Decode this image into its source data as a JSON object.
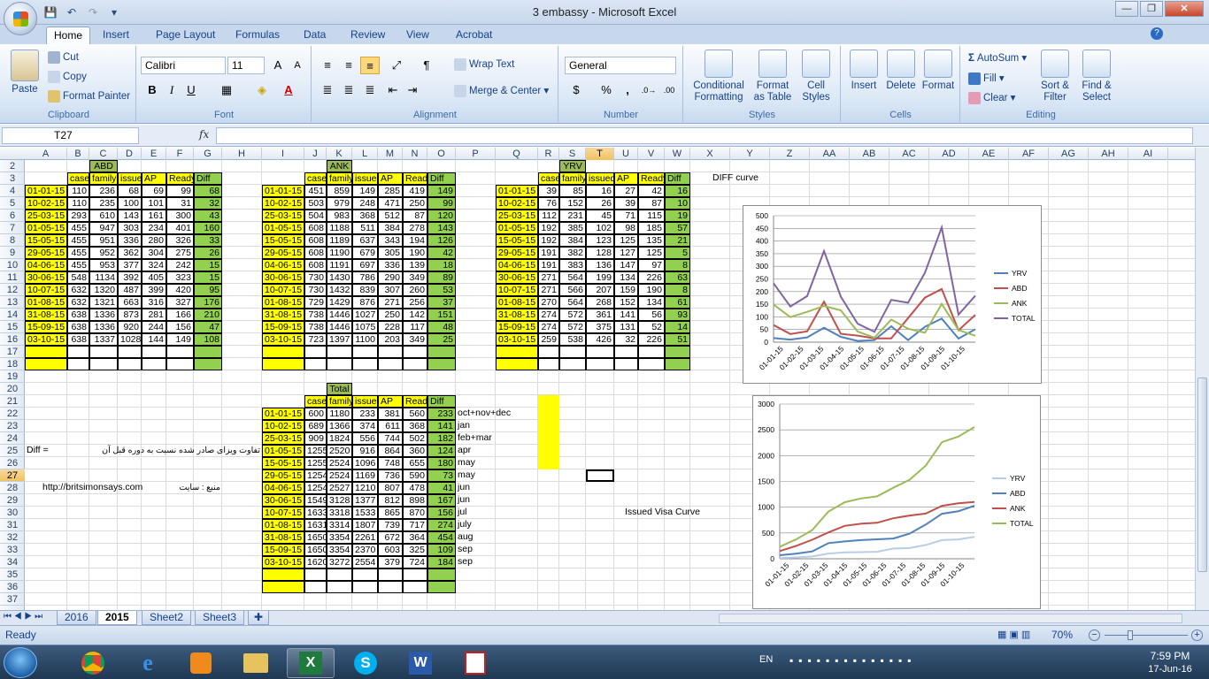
{
  "window": {
    "title": "3 embassy - Microsoft Excel",
    "minimize": "—",
    "restore": "❐",
    "close": "✕"
  },
  "ribbon_tabs": [
    "Home",
    "Insert",
    "Page Layout",
    "Formulas",
    "Data",
    "Review",
    "View",
    "Acrobat"
  ],
  "clipboard": {
    "paste": "Paste",
    "cut": "Cut",
    "copy": "Copy",
    "format_painter": "Format Painter",
    "group": "Clipboard"
  },
  "font": {
    "name": "Calibri",
    "size": "11",
    "bold": "B",
    "italic": "I",
    "underline": "U",
    "group": "Font"
  },
  "alignment": {
    "wrap": "Wrap Text",
    "merge": "Merge & Center",
    "group": "Alignment"
  },
  "number": {
    "format": "General",
    "currency": "$",
    "percent": "%",
    "comma": ",",
    "group": "Number"
  },
  "styles": {
    "conditional": "Conditional Formatting",
    "format_table": "Format as Table",
    "cell_styles": "Cell Styles",
    "group": "Styles"
  },
  "cells": {
    "insert": "Insert",
    "delete": "Delete",
    "format": "Format",
    "group": "Cells"
  },
  "editing": {
    "autosum": "AutoSum",
    "fill": "Fill",
    "clear": "Clear",
    "sort": "Sort & Filter",
    "find": "Find & Select",
    "group": "Editing"
  },
  "formula_bar": {
    "name_box": "T27",
    "fx": "fx",
    "value": ""
  },
  "columns": [
    "A",
    "B",
    "C",
    "D",
    "E",
    "F",
    "G",
    "H",
    "I",
    "J",
    "K",
    "L",
    "M",
    "N",
    "O",
    "P",
    "Q",
    "R",
    "S",
    "T",
    "U",
    "V",
    "W",
    "X",
    "Y",
    "Z",
    "AA",
    "AB",
    "AC",
    "AD",
    "AE",
    "AF",
    "AG",
    "AH",
    "AI"
  ],
  "rows": [
    "2",
    "3",
    "4",
    "5",
    "6",
    "7",
    "8",
    "9",
    "10",
    "11",
    "12",
    "13",
    "14",
    "15",
    "16",
    "17",
    "18",
    "19",
    "20",
    "21",
    "22",
    "23",
    "24",
    "25",
    "26",
    "27",
    "28",
    "29",
    "30",
    "31",
    "32",
    "33",
    "34",
    "35",
    "36",
    "37"
  ],
  "headers": [
    "case",
    "family",
    "issued",
    "AP",
    "Ready",
    "Diff"
  ],
  "dates": [
    "01-01-15",
    "10-02-15",
    "25-03-15",
    "01-05-15",
    "15-05-15",
    "29-05-15",
    "04-06-15",
    "30-06-15",
    "10-07-15",
    "01-08-15",
    "31-08-15",
    "15-09-15",
    "03-10-15"
  ],
  "abd": {
    "title": "ABD",
    "rows": [
      [
        110,
        236,
        68,
        69,
        99,
        68
      ],
      [
        110,
        235,
        100,
        101,
        31,
        32
      ],
      [
        293,
        610,
        143,
        161,
        300,
        43
      ],
      [
        455,
        947,
        303,
        234,
        401,
        160
      ],
      [
        455,
        951,
        336,
        280,
        326,
        33
      ],
      [
        455,
        952,
        362,
        304,
        275,
        26
      ],
      [
        455,
        953,
        377,
        324,
        242,
        15
      ],
      [
        548,
        1134,
        392,
        405,
        323,
        15
      ],
      [
        632,
        1320,
        487,
        399,
        420,
        95
      ],
      [
        632,
        1321,
        663,
        316,
        327,
        176
      ],
      [
        638,
        1336,
        873,
        281,
        166,
        210
      ],
      [
        638,
        1336,
        920,
        244,
        156,
        47
      ],
      [
        638,
        1337,
        1028,
        144,
        149,
        108
      ]
    ]
  },
  "ank": {
    "title": "ANK",
    "rows": [
      [
        451,
        859,
        149,
        285,
        419,
        149
      ],
      [
        503,
        979,
        248,
        471,
        250,
        99
      ],
      [
        504,
        983,
        368,
        512,
        87,
        120
      ],
      [
        608,
        1188,
        511,
        384,
        278,
        143
      ],
      [
        608,
        1189,
        637,
        343,
        194,
        126
      ],
      [
        608,
        1190,
        679,
        305,
        190,
        42
      ],
      [
        608,
        1191,
        697,
        336,
        139,
        18
      ],
      [
        730,
        1430,
        786,
        290,
        349,
        89
      ],
      [
        730,
        1432,
        839,
        307,
        260,
        53
      ],
      [
        729,
        1429,
        876,
        271,
        256,
        37
      ],
      [
        738,
        1446,
        1027,
        250,
        142,
        151
      ],
      [
        738,
        1446,
        1075,
        228,
        117,
        48
      ],
      [
        723,
        1397,
        1100,
        203,
        349,
        25
      ]
    ]
  },
  "yrv": {
    "title": "YRV",
    "rows": [
      [
        39,
        85,
        16,
        27,
        42,
        16
      ],
      [
        76,
        152,
        26,
        39,
        87,
        10
      ],
      [
        112,
        231,
        45,
        71,
        115,
        19
      ],
      [
        192,
        385,
        102,
        98,
        185,
        57
      ],
      [
        192,
        384,
        123,
        125,
        135,
        21
      ],
      [
        191,
        382,
        128,
        127,
        125,
        5
      ],
      [
        191,
        383,
        136,
        147,
        97,
        8
      ],
      [
        271,
        564,
        199,
        134,
        226,
        63
      ],
      [
        271,
        566,
        207,
        159,
        190,
        8
      ],
      [
        270,
        564,
        268,
        152,
        134,
        61
      ],
      [
        274,
        572,
        361,
        141,
        56,
        93
      ],
      [
        274,
        572,
        375,
        131,
        52,
        14
      ],
      [
        259,
        538,
        426,
        32,
        226,
        51
      ]
    ]
  },
  "total": {
    "title": "Total",
    "rows": [
      [
        600,
        1180,
        233,
        381,
        560,
        233
      ],
      [
        689,
        1366,
        374,
        611,
        368,
        141
      ],
      [
        909,
        1824,
        556,
        744,
        502,
        182
      ],
      [
        1255,
        2520,
        916,
        864,
        360,
        124
      ],
      [
        1255,
        2524,
        1096,
        748,
        655,
        180
      ],
      [
        1254,
        2524,
        1169,
        736,
        590,
        73
      ],
      [
        1254,
        2527,
        1210,
        807,
        478,
        41
      ],
      [
        1549,
        3128,
        1377,
        812,
        898,
        167
      ],
      [
        1633,
        3318,
        1533,
        865,
        870,
        156
      ],
      [
        1631,
        3314,
        1807,
        739,
        717,
        274
      ],
      [
        1650,
        3354,
        2261,
        672,
        364,
        454
      ],
      [
        1650,
        3354,
        2370,
        603,
        325,
        109
      ],
      [
        1620,
        3272,
        2554,
        379,
        724,
        184
      ]
    ],
    "notes": [
      "oct+nov+dec",
      "jan",
      "feb+mar",
      "apr",
      "may",
      "may",
      "jun",
      "jun",
      "jul",
      "july",
      "aug",
      "sep",
      "sep"
    ]
  },
  "diff_label": "Diff =",
  "diff_desc": "تفاوت ویزای صادر شده نسبت به دوره قبل آن",
  "source_url": "http://britsimonsays.com",
  "source_label": "منبع :  سایت",
  "chart1": {
    "title": "DIFF curve",
    "type": "line"
  },
  "chart2": {
    "title": "Issued Visa Curve",
    "type": "line"
  },
  "chart_data": [
    {
      "type": "line",
      "title": "DIFF curve",
      "categories": [
        "01-01-15",
        "01-02-15",
        "01-03-15",
        "01-04-15",
        "01-05-15",
        "01-06-15",
        "01-07-15",
        "01-08-15",
        "01-09-15",
        "01-10-15"
      ],
      "ylim": [
        0,
        500
      ],
      "yticks": [
        0,
        50,
        100,
        150,
        200,
        250,
        300,
        350,
        400,
        450,
        500
      ],
      "legend": "right",
      "series": [
        {
          "name": "YRV",
          "color": "#4f81bd",
          "values": [
            16,
            10,
            19,
            57,
            21,
            5,
            8,
            63,
            8,
            61,
            93,
            14,
            51
          ]
        },
        {
          "name": "ABD",
          "color": "#c0504d",
          "values": [
            68,
            32,
            43,
            160,
            33,
            26,
            15,
            15,
            95,
            176,
            210,
            47,
            108
          ]
        },
        {
          "name": "ANK",
          "color": "#9bbb59",
          "values": [
            149,
            99,
            120,
            143,
            126,
            42,
            18,
            89,
            53,
            37,
            151,
            48,
            25
          ]
        },
        {
          "name": "TOTAL",
          "color": "#8064a2",
          "values": [
            233,
            141,
            182,
            360,
            180,
            73,
            41,
            167,
            156,
            274,
            454,
            109,
            184
          ]
        }
      ]
    },
    {
      "type": "line",
      "title": "Issued Visa Curve",
      "categories": [
        "01-01-15",
        "01-02-15",
        "01-03-15",
        "01-04-15",
        "01-05-15",
        "01-06-15",
        "01-07-15",
        "01-08-15",
        "01-09-15",
        "01-10-15"
      ],
      "ylim": [
        0,
        3000
      ],
      "yticks": [
        0,
        500,
        1000,
        1500,
        2000,
        2500,
        3000
      ],
      "legend": "right",
      "series": [
        {
          "name": "YRV",
          "color": "#b9cde5",
          "values": [
            16,
            26,
            45,
            102,
            123,
            128,
            136,
            199,
            207,
            268,
            361,
            375,
            426
          ]
        },
        {
          "name": "ABD",
          "color": "#4f81bd",
          "values": [
            68,
            100,
            143,
            303,
            336,
            362,
            377,
            392,
            487,
            663,
            873,
            920,
            1028
          ]
        },
        {
          "name": "ANK",
          "color": "#c0504d",
          "values": [
            149,
            248,
            368,
            511,
            637,
            679,
            697,
            786,
            839,
            876,
            1027,
            1075,
            1100
          ]
        },
        {
          "name": "TOTAL",
          "color": "#9bbb59",
          "values": [
            233,
            374,
            556,
            916,
            1096,
            1169,
            1210,
            1377,
            1533,
            1807,
            2261,
            2370,
            2554
          ]
        }
      ]
    }
  ],
  "sheet_tabs": [
    "2016",
    "2015",
    "Sheet2",
    "Sheet3"
  ],
  "status": {
    "ready": "Ready",
    "zoom": "70%"
  },
  "taskbar": {
    "lang": "EN",
    "time": "7:59 PM",
    "date": "17-Jun-16"
  }
}
